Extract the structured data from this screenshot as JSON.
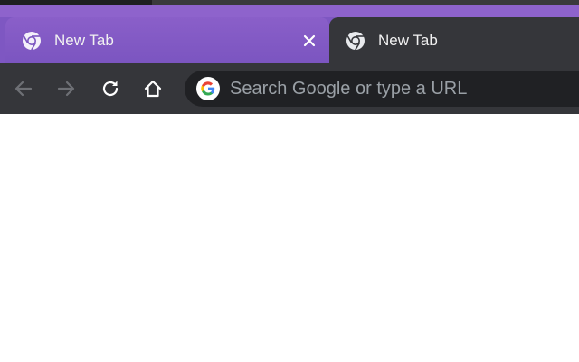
{
  "browser": {
    "accent_color": "#7e57c2",
    "toolbar_color": "#35363a",
    "omnibox_color": "#202124"
  },
  "tabs": [
    {
      "title": "New Tab",
      "active": true,
      "icon": "chrome-icon",
      "close_icon": "close-icon"
    },
    {
      "title": "New Tab",
      "active": false,
      "icon": "chrome-icon"
    }
  ],
  "toolbar": {
    "back_icon": "back-arrow-icon",
    "forward_icon": "forward-arrow-icon",
    "reload_icon": "reload-icon",
    "home_icon": "home-icon"
  },
  "omnibox": {
    "icon": "google-g-icon",
    "placeholder": "Search Google or type a URL"
  }
}
